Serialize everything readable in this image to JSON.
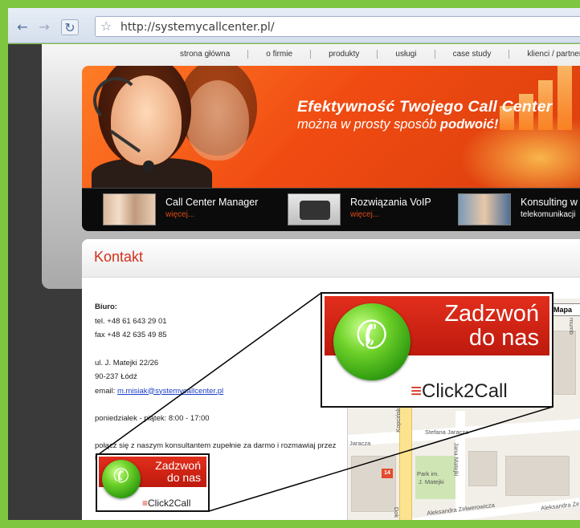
{
  "browser": {
    "back_icon": "back-arrow-icon",
    "forward_icon": "forward-arrow-icon",
    "reload_icon": "reload-icon",
    "bookmark_icon": "star-icon",
    "url": "http://systemycallcenter.pl/"
  },
  "nav": {
    "items": [
      "strona główna",
      "o firmie",
      "produkty",
      "usługi",
      "case study",
      "klienci / partnerzy"
    ]
  },
  "banner": {
    "headline": "Efektywność Twojego Call Center",
    "subline_prefix": "można w prosty sposób ",
    "subline_bold": "podwoić!",
    "promos": [
      {
        "title": "Call Center Manager",
        "link": "więcej..."
      },
      {
        "title": "Rozwiązania VoIP",
        "link": "więcej..."
      },
      {
        "title": "Konsulting w",
        "sub": "telekomunikacji"
      }
    ]
  },
  "contact": {
    "heading": "Kontakt",
    "office_label": "Biuro:",
    "tel": "tel. +48 61 643 29 01",
    "fax": "fax +48 42 635 49 85",
    "street": "ul. J. Matejki 22/26",
    "city": "90-237 Łódź",
    "email_label": "email: ",
    "email": "m.misiak@systemycallcenter.pl",
    "hours": "poniedziałek - piątek: 8:00 - 17:00",
    "invite": "połącz się z naszym konsultantem zupełnie za darmo i rozmawiaj przez internet:"
  },
  "click2call": {
    "line1": "Zadzwoń",
    "line2": "do nas",
    "brand": "Click2Call"
  },
  "map": {
    "button": "Mapa",
    "streets": [
      "Stefana Jaracza",
      "Jaracza",
      "Kopcińskiego",
      "Jana Matejki",
      "Aleksandra Zelwerowicza",
      "Aleksandra Ze",
      "Dok"
    ],
    "park": "Park im.",
    "park2": "J. Matejki",
    "route": "14",
    "edge_label": "mumb"
  },
  "colors": {
    "frame_green": "#7ec63f",
    "accent_red": "#d2311b",
    "banner_orange": "#f04b12",
    "link_blue": "#1a3ec8"
  }
}
